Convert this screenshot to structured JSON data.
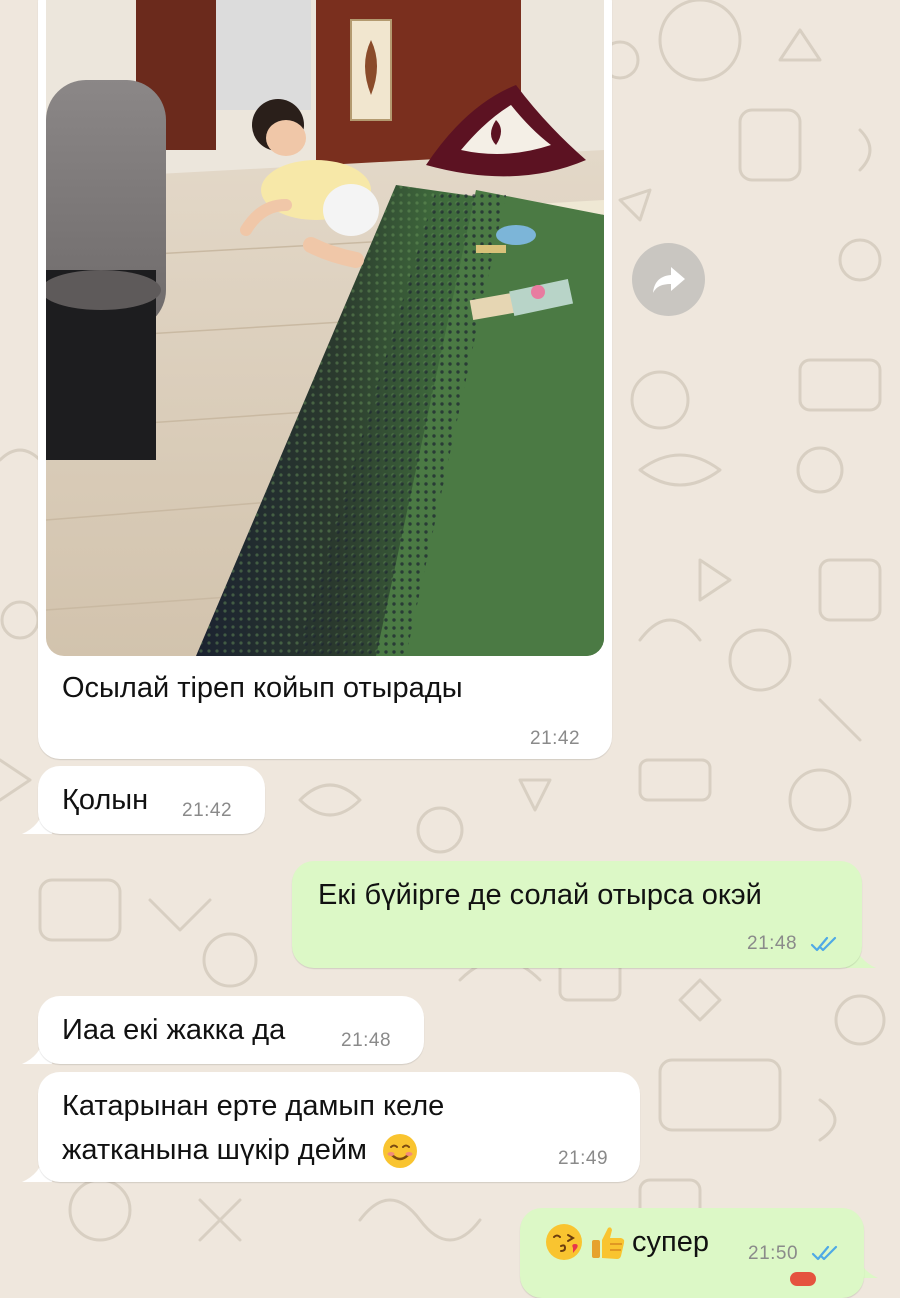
{
  "colors": {
    "wallpaper": "#efe7dd",
    "incoming_bubble": "#ffffff",
    "outgoing_bubble": "#dcf8c6",
    "read_ticks": "#4fa9e6",
    "timestamp": "#8a8a8a"
  },
  "forward_button": {
    "icon": "forward-arrow-icon"
  },
  "messages": [
    {
      "direction": "incoming",
      "type": "photo",
      "photo_description_icon": "photo-image",
      "caption": "Осылай тіреп койып отырады",
      "time": "21:42"
    },
    {
      "direction": "incoming",
      "type": "text",
      "text": "Қолын",
      "time": "21:42"
    },
    {
      "direction": "outgoing",
      "type": "text",
      "text": "Екі бүйірге де солай отырса окэй",
      "time": "21:48",
      "status": "read"
    },
    {
      "direction": "incoming",
      "type": "text",
      "text": "Иаа екі жакка да",
      "time": "21:48"
    },
    {
      "direction": "incoming",
      "type": "text",
      "lines": [
        "Катарынан ерте дамып келе",
        "жатканына шүкір дейм"
      ],
      "emoji": "smiling-face-icon",
      "time": "21:49"
    },
    {
      "direction": "outgoing",
      "type": "text",
      "emojis": [
        "face-blowing-kiss-icon",
        "thumbs-up-icon"
      ],
      "text": "супер",
      "time": "21:50",
      "status": "read"
    }
  ]
}
